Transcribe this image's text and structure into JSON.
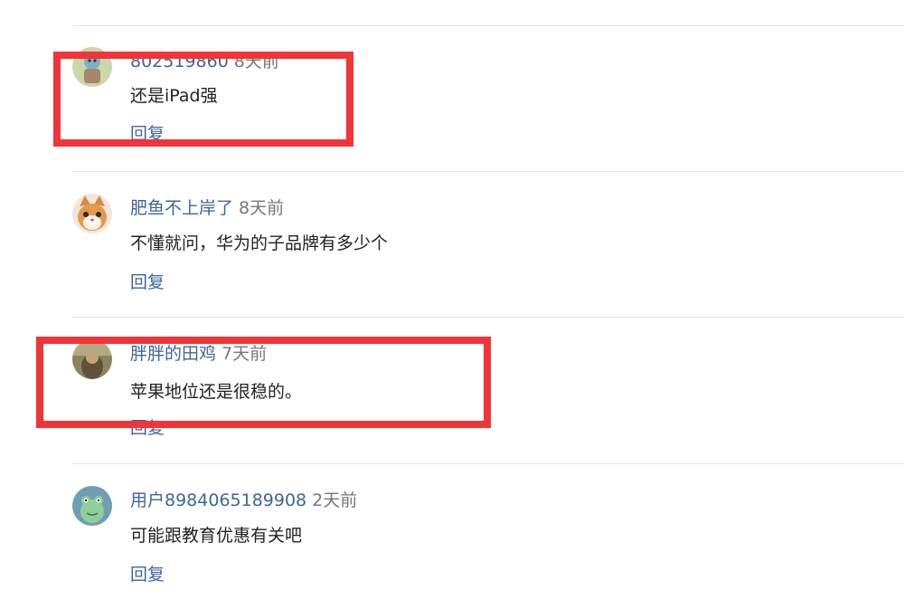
{
  "comments": [
    {
      "username": "802519860",
      "time": "8天前",
      "text": "还是iPad强",
      "reply_label": "回复",
      "avatar_icon": "avatar-cartoon-icon"
    },
    {
      "username": "肥鱼不上岸了",
      "time": "8天前",
      "text": "不懂就问，华为的子品牌有多少个",
      "reply_label": "回复",
      "avatar_icon": "avatar-cat-icon"
    },
    {
      "username": "胖胖的田鸡",
      "time": "7天前",
      "text": "苹果地位还是很稳的。",
      "reply_label": "回复",
      "avatar_icon": "avatar-photo-icon"
    },
    {
      "username": "用户8984065189908",
      "time": "2天前",
      "text": "可能跟教育优惠有关吧",
      "reply_label": "回复",
      "avatar_icon": "avatar-frog-icon"
    }
  ],
  "colors": {
    "username": "#406599",
    "time": "#777777",
    "text": "#222222",
    "highlight": "#f03437",
    "divider": "#e6e6e6"
  }
}
